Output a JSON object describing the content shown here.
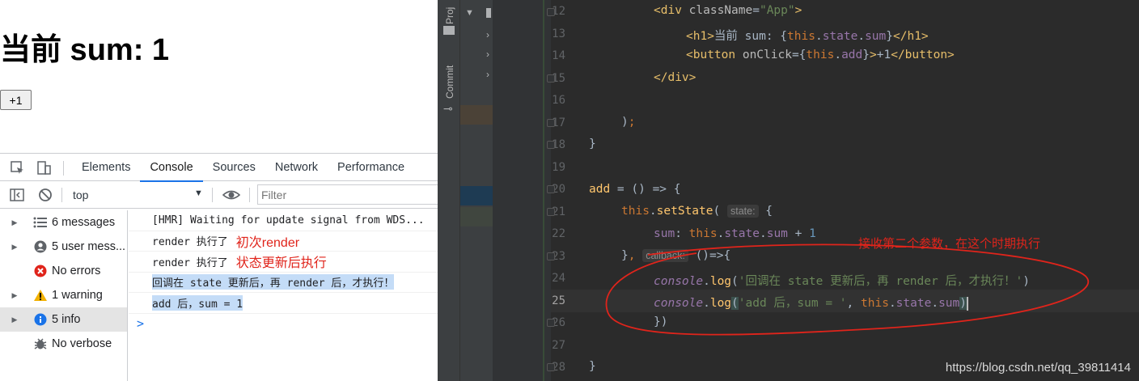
{
  "page": {
    "heading": "当前 sum: 1",
    "button_label": "+1"
  },
  "devtools": {
    "tabs": [
      "Elements",
      "Console",
      "Sources",
      "Network",
      "Performance"
    ],
    "active_tab": "Console",
    "context": "top",
    "filter_placeholder": "Filter",
    "sidebar": [
      {
        "label": "6 messages",
        "icon": "list-icon"
      },
      {
        "label": "5 user mess...",
        "icon": "user-icon"
      },
      {
        "label": "No errors",
        "icon": "error-icon"
      },
      {
        "label": "1 warning",
        "icon": "warning-icon"
      },
      {
        "label": "5 info",
        "icon": "info-icon"
      },
      {
        "label": "No verbose",
        "icon": "bug-icon"
      }
    ],
    "log": [
      {
        "text": "[HMR] Waiting for update signal from WDS...",
        "note": ""
      },
      {
        "text": "render 执行了",
        "note": "初次render"
      },
      {
        "text": "render 执行了",
        "note": "状态更新后执行"
      },
      {
        "text": "回调在 state 更新后，再 render 后，才执行！",
        "note": ""
      },
      {
        "text": "add 后，sum =  1",
        "note": ""
      }
    ],
    "prompt": ">"
  },
  "ide": {
    "side_tabs": [
      "Proj",
      "Commit"
    ],
    "line_numbers": [
      "12",
      "13",
      "14",
      "15",
      "16",
      "17",
      "18",
      "19",
      "20",
      "21",
      "22",
      "23",
      "24",
      "25",
      "26",
      "27",
      "28"
    ],
    "current_line": "25",
    "hints": {
      "state": "state:",
      "callback": "callback:"
    },
    "annotation": "接收第二个参数，在这个时期执行",
    "watermark": "https://blog.csdn.net/qq_39811414"
  },
  "colors": {
    "annotation": "#e0241b",
    "accent": "#1a73e8",
    "editor_bg": "#2b2b2b"
  }
}
